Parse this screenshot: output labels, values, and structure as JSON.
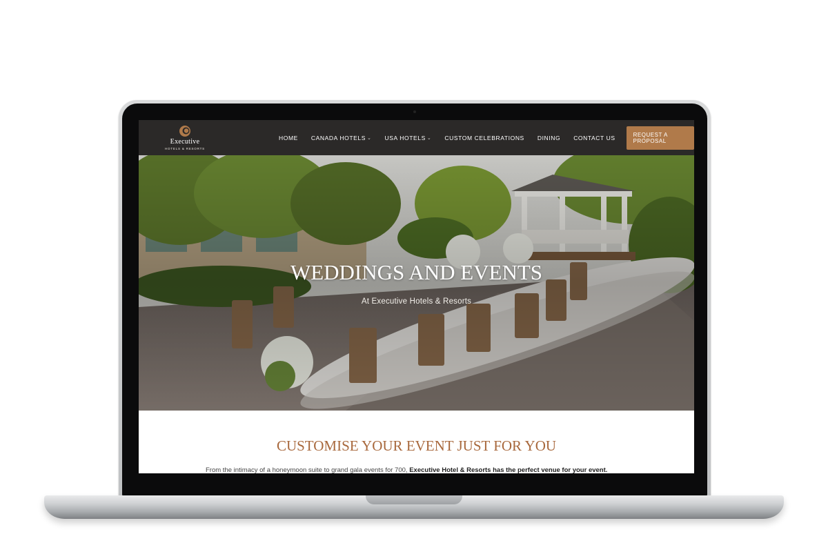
{
  "header": {
    "logo": {
      "name": "Executive",
      "sub": "HOTELS & RESORTS"
    },
    "nav": [
      {
        "label": "HOME",
        "dropdown": false
      },
      {
        "label": "CANADA HOTELS",
        "dropdown": true
      },
      {
        "label": "USA HOTELS",
        "dropdown": true
      },
      {
        "label": "CUSTOM CELEBRATIONS",
        "dropdown": false
      },
      {
        "label": "DINING",
        "dropdown": false
      },
      {
        "label": "CONTACT US",
        "dropdown": false
      }
    ],
    "cta_label": "REQUEST A PROPOSAL"
  },
  "hero": {
    "title": "WEDDINGS AND EVENTS",
    "subtitle": "At Executive Hotels & Resorts"
  },
  "content": {
    "section_title": "CUSTOMISE YOUR EVENT JUST FOR YOU",
    "intro_plain": "From the intimacy of a honeymoon suite to grand gala events for 700, ",
    "intro_bold": "Executive Hotel & Resorts has the perfect venue for your event."
  },
  "colors": {
    "header_bg": "#2b2928",
    "accent": "#b07a4a",
    "section_title": "#a8683c"
  }
}
